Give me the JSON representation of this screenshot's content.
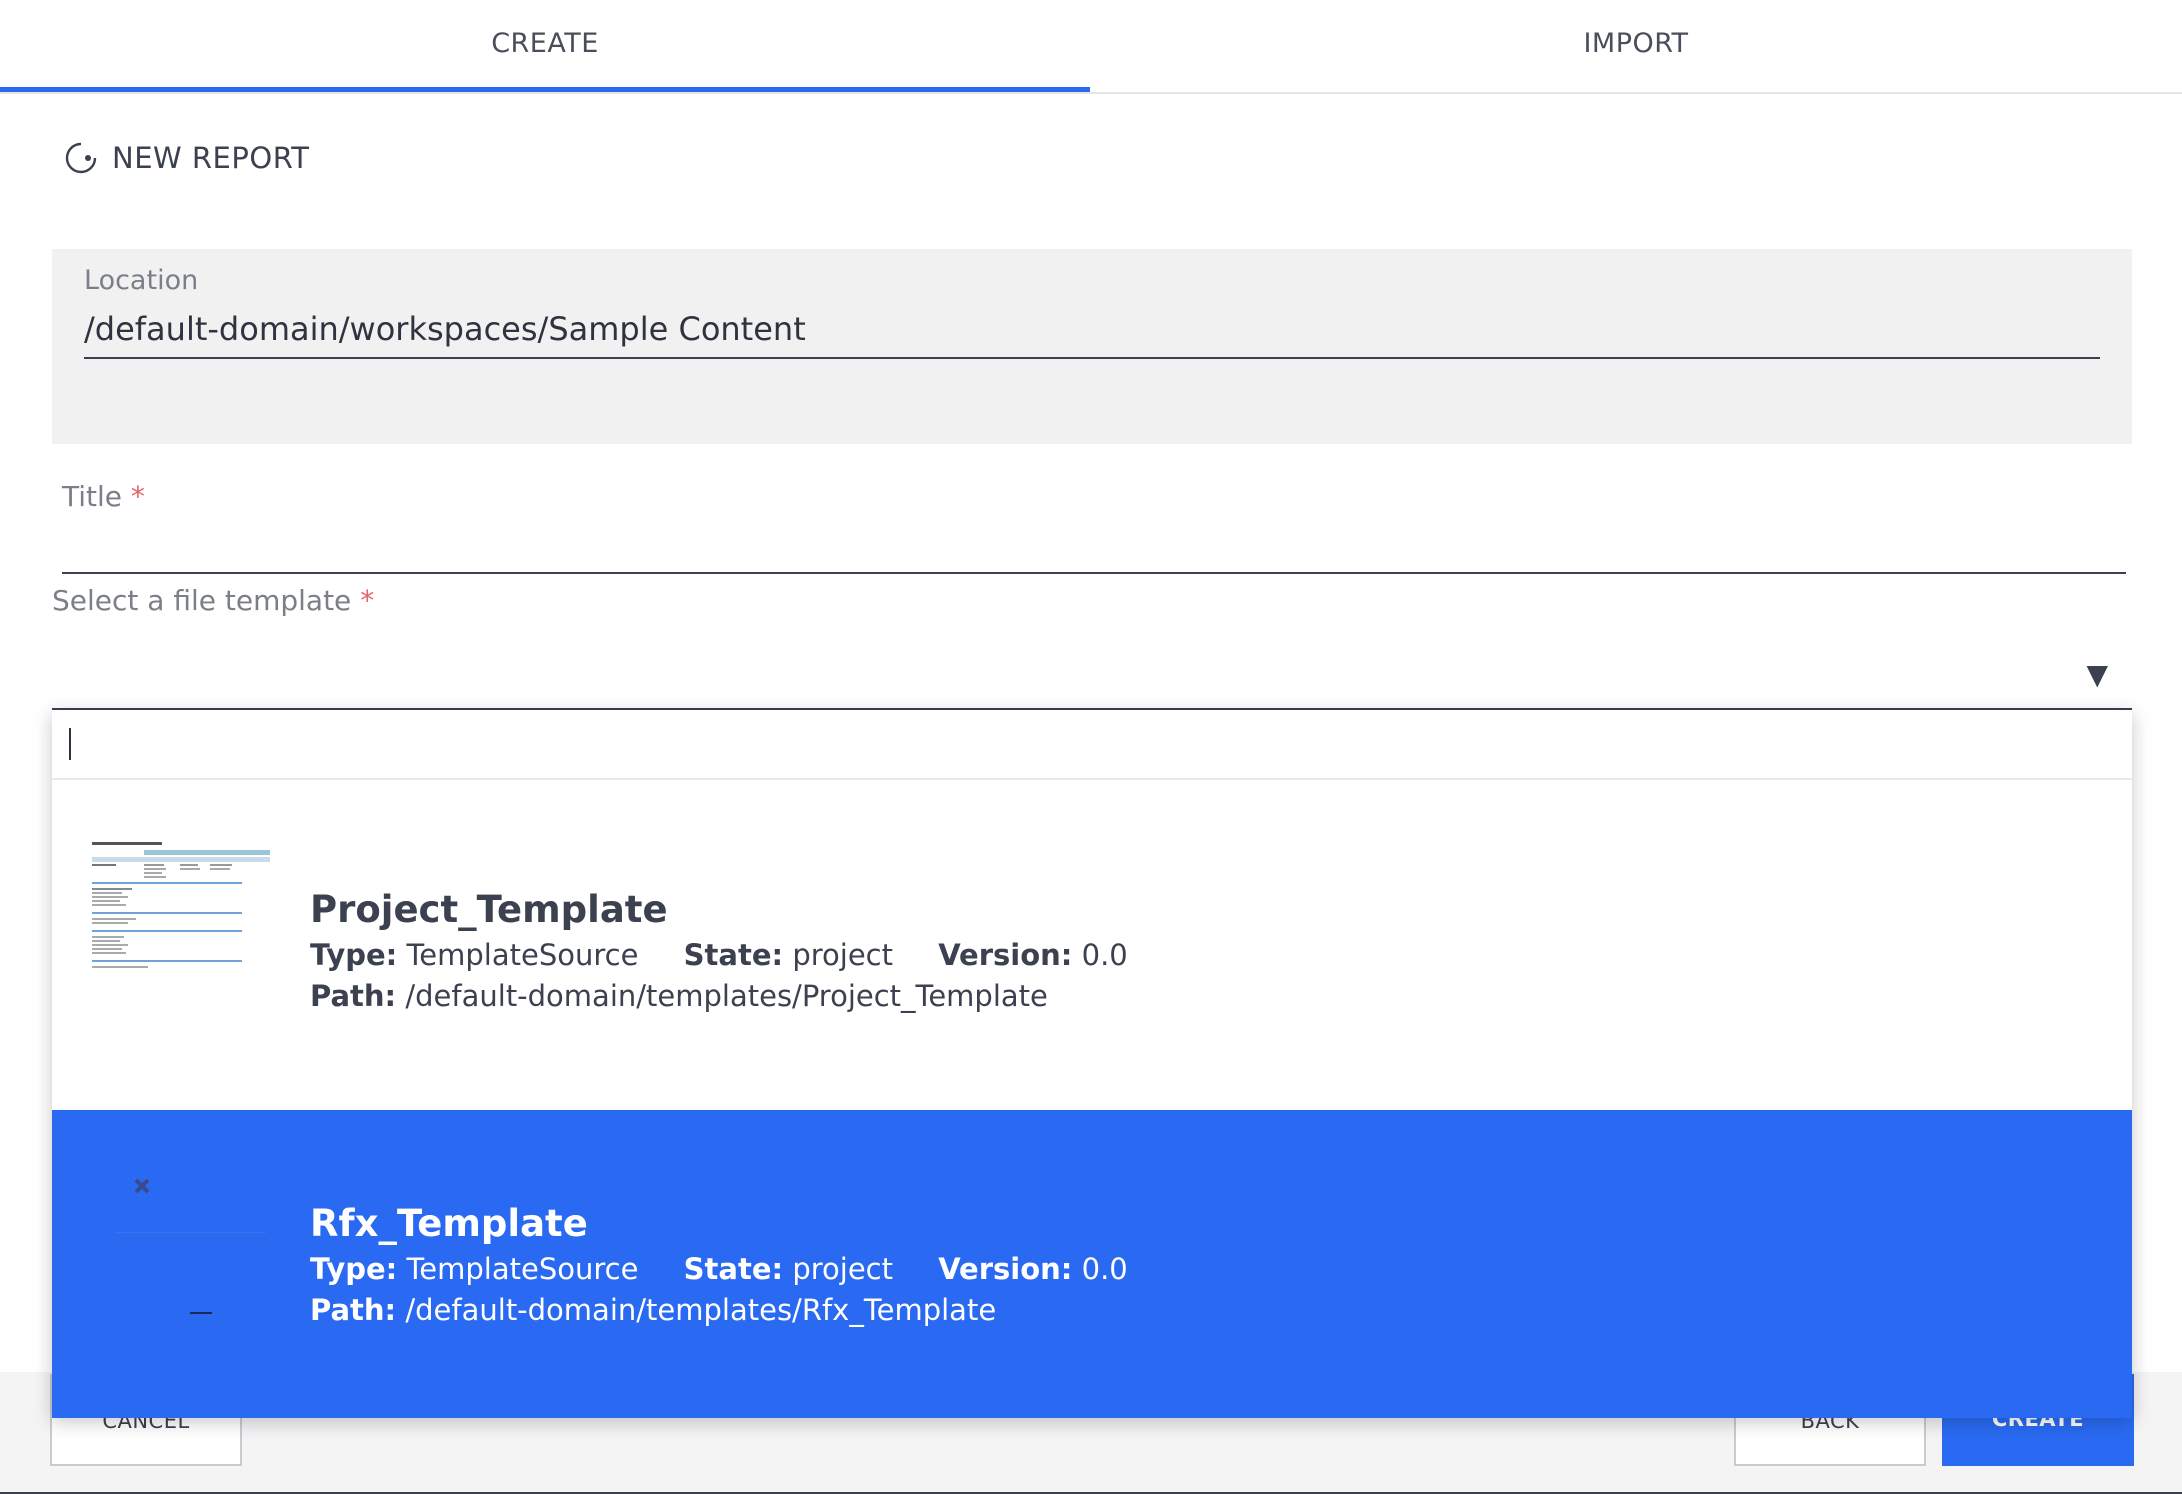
{
  "tabs": [
    {
      "label": "CREATE",
      "active": true
    },
    {
      "label": "IMPORT",
      "active": false
    }
  ],
  "header": {
    "label": "NEW REPORT",
    "icon": "new-report-icon"
  },
  "location": {
    "label": "Location",
    "value": "/default-domain/workspaces/Sample Content"
  },
  "title_field": {
    "label": "Title",
    "required_mark": "*",
    "value": ""
  },
  "template_select": {
    "label": "Select a file template",
    "required_mark": "*",
    "arrow": "▼",
    "search_value": ""
  },
  "options": [
    {
      "name": "Project_Template",
      "type_label": "Type:",
      "type_value": "TemplateSource",
      "state_label": "State:",
      "state_value": "project",
      "version_label": "Version:",
      "version_value": "0.0",
      "path_label": "Path:",
      "path_value": "/default-domain/templates/Project_Template",
      "highlighted": false
    },
    {
      "name": "Rfx_Template",
      "type_label": "Type:",
      "type_value": "TemplateSource",
      "state_label": "State:",
      "state_value": "project",
      "version_label": "Version:",
      "version_value": "0.0",
      "path_label": "Path:",
      "path_value": "/default-domain/templates/Rfx_Template",
      "highlighted": true
    }
  ],
  "footer": {
    "cancel": "CANCEL",
    "back": "BACK",
    "create": "CREATE"
  },
  "colors": {
    "accent": "#2a6af2",
    "text": "#3c4150",
    "required": "#e5636b",
    "field_bg": "#f1f1f2"
  }
}
